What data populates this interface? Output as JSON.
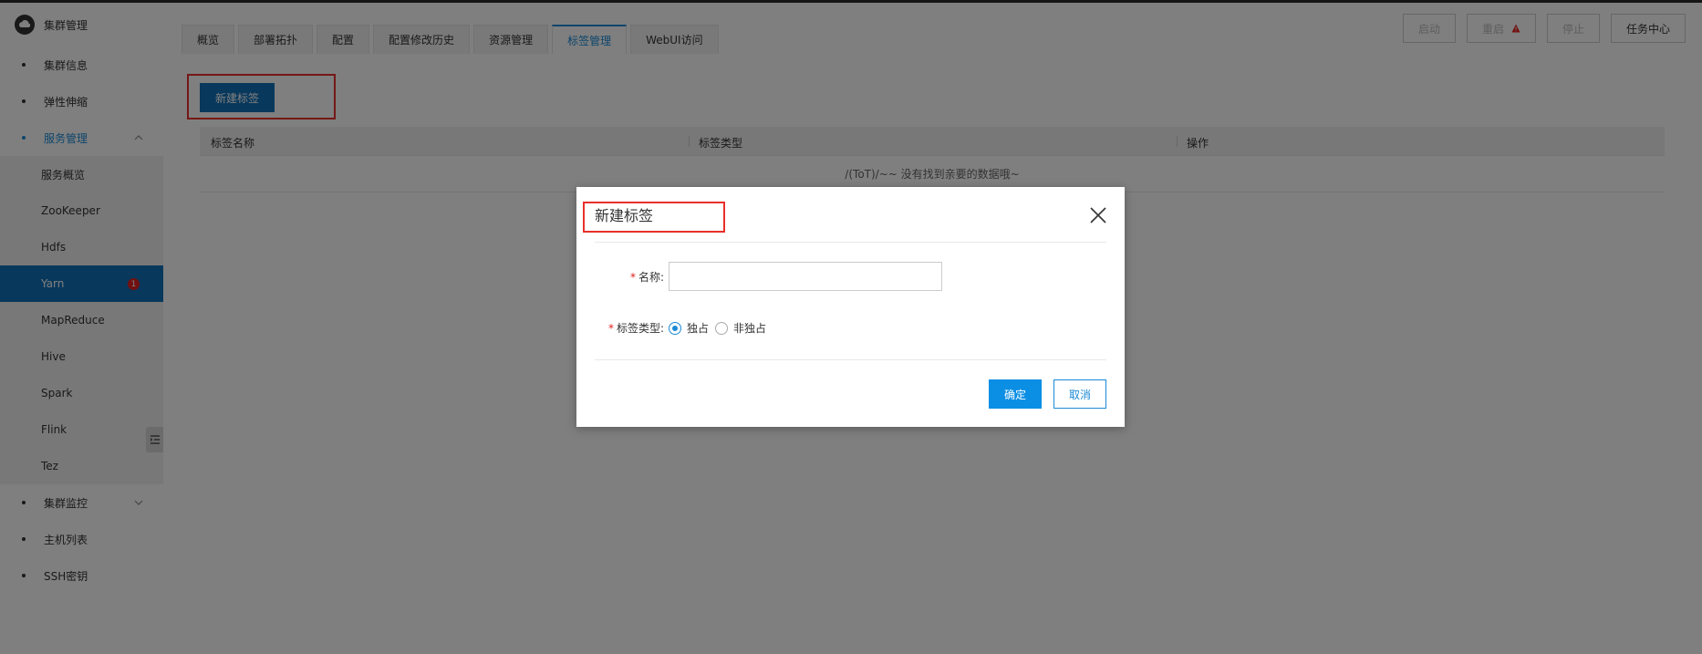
{
  "sidebar": {
    "brand": "集群管理",
    "items": [
      {
        "label": "集群信息"
      },
      {
        "label": "弹性伸缩"
      },
      {
        "label": "服务管理"
      }
    ],
    "services": [
      {
        "label": "服务概览"
      },
      {
        "label": "ZooKeeper"
      },
      {
        "label": "Hdfs"
      },
      {
        "label": "Yarn",
        "badge": "1"
      },
      {
        "label": "MapReduce"
      },
      {
        "label": "Hive"
      },
      {
        "label": "Spark"
      },
      {
        "label": "Flink"
      },
      {
        "label": "Tez"
      }
    ],
    "bottom_items": [
      {
        "label": "集群监控"
      },
      {
        "label": "主机列表"
      },
      {
        "label": "SSH密钥"
      }
    ]
  },
  "tabs": [
    {
      "label": "概览"
    },
    {
      "label": "部署拓扑"
    },
    {
      "label": "配置"
    },
    {
      "label": "配置修改历史"
    },
    {
      "label": "资源管理"
    },
    {
      "label": "标签管理"
    },
    {
      "label": "WebUI访问"
    }
  ],
  "actions": {
    "start": "启动",
    "restart": "重启",
    "stop": "停止",
    "task_center": "任务中心"
  },
  "toolbar": {
    "new_tag": "新建标签"
  },
  "table": {
    "columns": [
      "标签名称",
      "标签类型",
      "操作"
    ],
    "empty_text": "/(ToT)/~~ 没有找到亲要的数据哦~"
  },
  "modal": {
    "title": "新建标签",
    "name_label": "名称:",
    "name_value": "",
    "type_label": "标签类型:",
    "type_options": [
      "独占",
      "非独占"
    ],
    "selected_type": "独占",
    "ok": "确定",
    "cancel": "取消"
  },
  "colors": {
    "primary": "#1170b8",
    "accent": "#1a8ad6",
    "highlight": "#e8302a",
    "required": "#e02020"
  }
}
